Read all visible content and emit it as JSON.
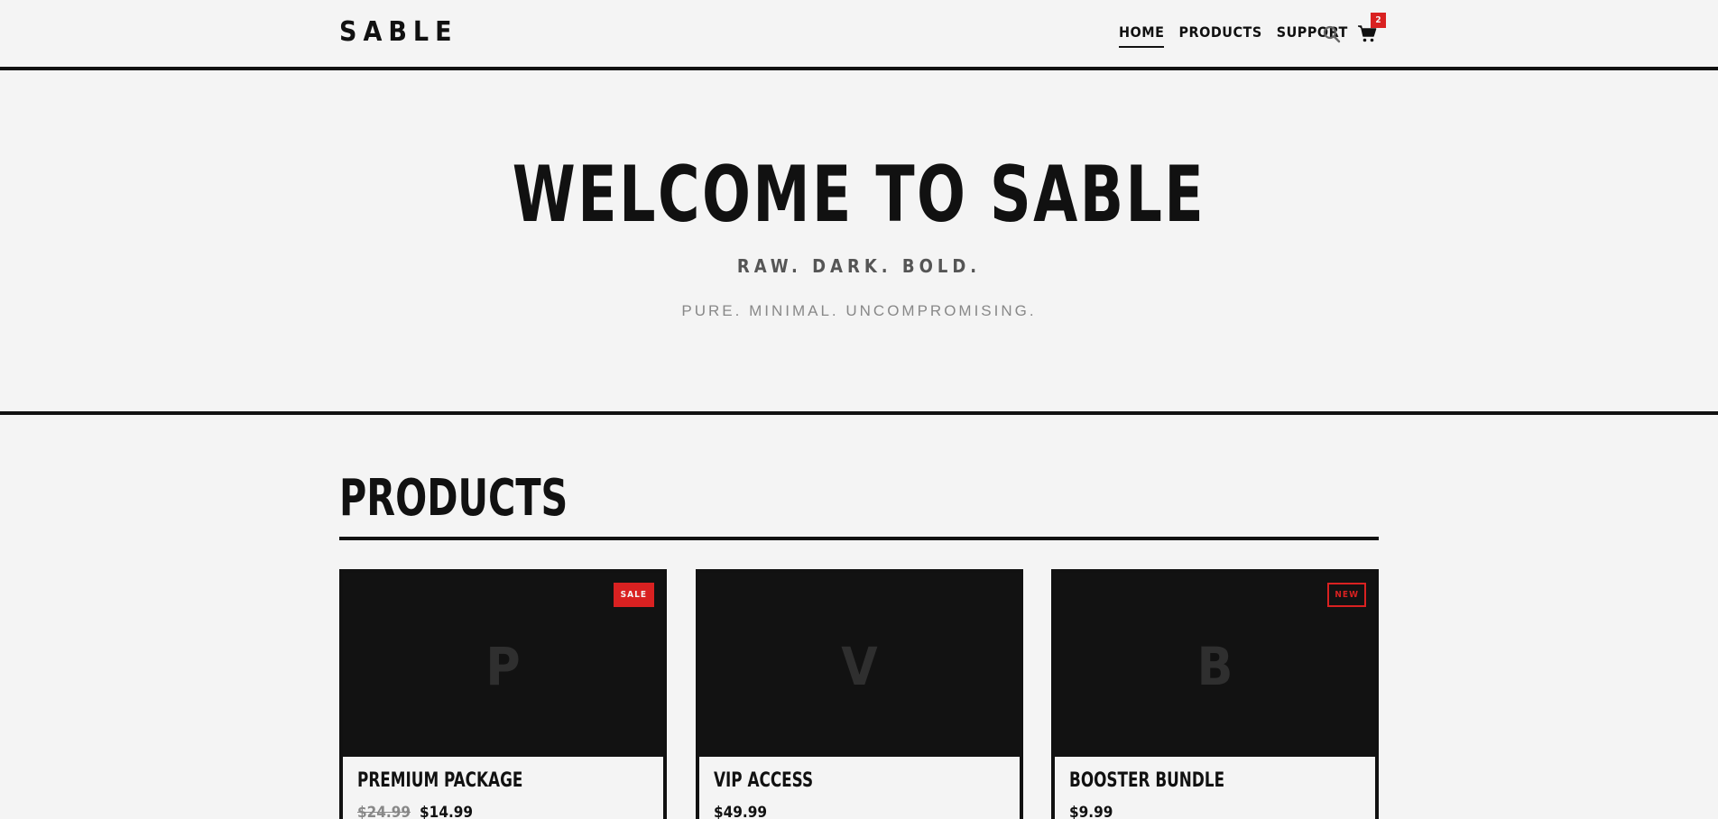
{
  "header": {
    "logo": "SABLE",
    "nav": [
      {
        "label": "HOME",
        "active": true
      },
      {
        "label": "PRODUCTS",
        "active": false
      },
      {
        "label": "SUPPORT",
        "active": false
      }
    ],
    "cart_count": "2",
    "icons": [
      "search-icon",
      "cart-icon"
    ]
  },
  "hero": {
    "title": "WELCOME TO SABLE",
    "subtitle": "RAW. DARK. BOLD.",
    "tagline": "PURE. MINIMAL. UNCOMPROMISING."
  },
  "products": {
    "title": "PRODUCTS",
    "items": [
      {
        "initial": "P",
        "name": "PREMIUM PACKAGE",
        "old_price": "$24.99",
        "price": "$14.99",
        "badge": "SALE"
      },
      {
        "initial": "V",
        "name": "VIP ACCESS",
        "price": "$49.99"
      },
      {
        "initial": "B",
        "name": "BOOSTER BUNDLE",
        "price": "$9.99",
        "badge": "NEW"
      }
    ]
  },
  "colors": {
    "background": "#f4f4f4",
    "ink": "#111111",
    "accent": "#d92121",
    "card_image": "#121212"
  }
}
